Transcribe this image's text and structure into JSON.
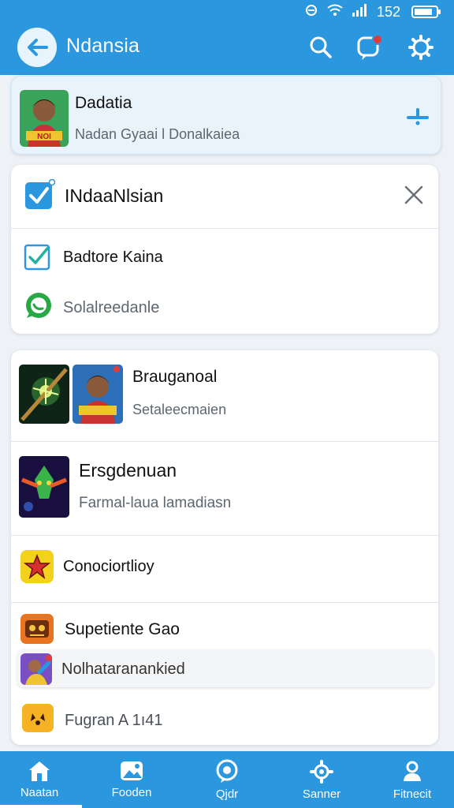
{
  "status": {
    "time": "152"
  },
  "header": {
    "title": "Ndansia"
  },
  "profile": {
    "title": "Dadatia",
    "subtitle": "Nadan Gyaai l Donalkaiea",
    "badge_text": "NOI"
  },
  "notice": {
    "title": "INdaaNlsian",
    "items": [
      {
        "label": "Badtore Kaina"
      },
      {
        "label": "Solalreedanle"
      }
    ]
  },
  "list": [
    {
      "title": "Brauganoal",
      "subtitle": "Setaleecmaien"
    },
    {
      "title": "Ersgdenuan",
      "subtitle": "Farmal-laua lamadiasn"
    },
    {
      "title": "Conociortlioy"
    },
    {
      "title": "Supetiente Gao"
    },
    {
      "title": "Nolhataranankied"
    },
    {
      "title": "Fugran A 1ı41"
    }
  ],
  "bottom_nav": [
    {
      "label": "Naatan",
      "icon": "home-icon"
    },
    {
      "label": "Fooden",
      "icon": "gallery-icon"
    },
    {
      "label": "Qjdr",
      "icon": "chat-icon"
    },
    {
      "label": "Sanner",
      "icon": "settings-icon"
    },
    {
      "label": "Fitnecit",
      "icon": "person-icon"
    }
  ],
  "colors": {
    "primary": "#2b97de",
    "accent_red": "#e33b3b",
    "check_blue": "#2b97de",
    "green": "#27a844"
  }
}
